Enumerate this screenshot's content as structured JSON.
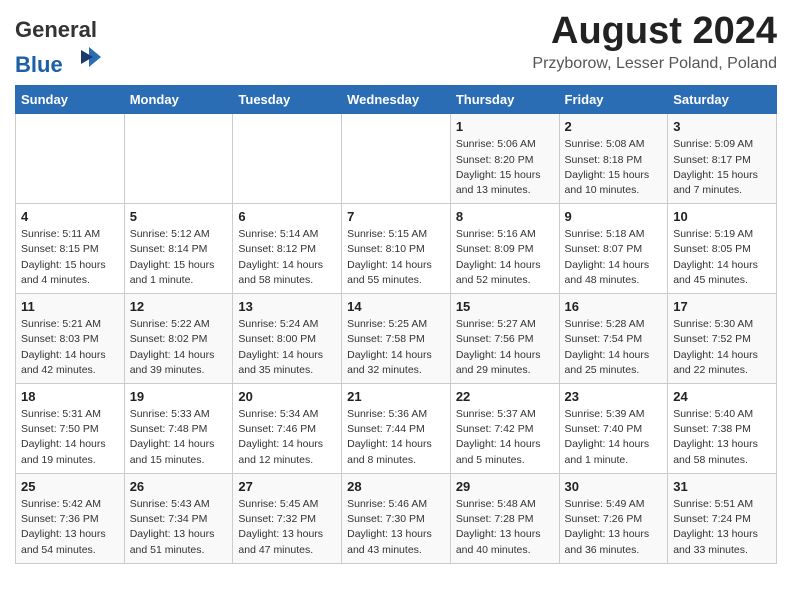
{
  "header": {
    "logo_general": "General",
    "logo_blue": "Blue",
    "title": "August 2024",
    "subtitle": "Przyborow, Lesser Poland, Poland"
  },
  "days_of_week": [
    "Sunday",
    "Monday",
    "Tuesday",
    "Wednesday",
    "Thursday",
    "Friday",
    "Saturday"
  ],
  "weeks": [
    [
      {
        "day": "",
        "info": ""
      },
      {
        "day": "",
        "info": ""
      },
      {
        "day": "",
        "info": ""
      },
      {
        "day": "",
        "info": ""
      },
      {
        "day": "1",
        "info": "Sunrise: 5:06 AM\nSunset: 8:20 PM\nDaylight: 15 hours\nand 13 minutes."
      },
      {
        "day": "2",
        "info": "Sunrise: 5:08 AM\nSunset: 8:18 PM\nDaylight: 15 hours\nand 10 minutes."
      },
      {
        "day": "3",
        "info": "Sunrise: 5:09 AM\nSunset: 8:17 PM\nDaylight: 15 hours\nand 7 minutes."
      }
    ],
    [
      {
        "day": "4",
        "info": "Sunrise: 5:11 AM\nSunset: 8:15 PM\nDaylight: 15 hours\nand 4 minutes."
      },
      {
        "day": "5",
        "info": "Sunrise: 5:12 AM\nSunset: 8:14 PM\nDaylight: 15 hours\nand 1 minute."
      },
      {
        "day": "6",
        "info": "Sunrise: 5:14 AM\nSunset: 8:12 PM\nDaylight: 14 hours\nand 58 minutes."
      },
      {
        "day": "7",
        "info": "Sunrise: 5:15 AM\nSunset: 8:10 PM\nDaylight: 14 hours\nand 55 minutes."
      },
      {
        "day": "8",
        "info": "Sunrise: 5:16 AM\nSunset: 8:09 PM\nDaylight: 14 hours\nand 52 minutes."
      },
      {
        "day": "9",
        "info": "Sunrise: 5:18 AM\nSunset: 8:07 PM\nDaylight: 14 hours\nand 48 minutes."
      },
      {
        "day": "10",
        "info": "Sunrise: 5:19 AM\nSunset: 8:05 PM\nDaylight: 14 hours\nand 45 minutes."
      }
    ],
    [
      {
        "day": "11",
        "info": "Sunrise: 5:21 AM\nSunset: 8:03 PM\nDaylight: 14 hours\nand 42 minutes."
      },
      {
        "day": "12",
        "info": "Sunrise: 5:22 AM\nSunset: 8:02 PM\nDaylight: 14 hours\nand 39 minutes."
      },
      {
        "day": "13",
        "info": "Sunrise: 5:24 AM\nSunset: 8:00 PM\nDaylight: 14 hours\nand 35 minutes."
      },
      {
        "day": "14",
        "info": "Sunrise: 5:25 AM\nSunset: 7:58 PM\nDaylight: 14 hours\nand 32 minutes."
      },
      {
        "day": "15",
        "info": "Sunrise: 5:27 AM\nSunset: 7:56 PM\nDaylight: 14 hours\nand 29 minutes."
      },
      {
        "day": "16",
        "info": "Sunrise: 5:28 AM\nSunset: 7:54 PM\nDaylight: 14 hours\nand 25 minutes."
      },
      {
        "day": "17",
        "info": "Sunrise: 5:30 AM\nSunset: 7:52 PM\nDaylight: 14 hours\nand 22 minutes."
      }
    ],
    [
      {
        "day": "18",
        "info": "Sunrise: 5:31 AM\nSunset: 7:50 PM\nDaylight: 14 hours\nand 19 minutes."
      },
      {
        "day": "19",
        "info": "Sunrise: 5:33 AM\nSunset: 7:48 PM\nDaylight: 14 hours\nand 15 minutes."
      },
      {
        "day": "20",
        "info": "Sunrise: 5:34 AM\nSunset: 7:46 PM\nDaylight: 14 hours\nand 12 minutes."
      },
      {
        "day": "21",
        "info": "Sunrise: 5:36 AM\nSunset: 7:44 PM\nDaylight: 14 hours\nand 8 minutes."
      },
      {
        "day": "22",
        "info": "Sunrise: 5:37 AM\nSunset: 7:42 PM\nDaylight: 14 hours\nand 5 minutes."
      },
      {
        "day": "23",
        "info": "Sunrise: 5:39 AM\nSunset: 7:40 PM\nDaylight: 14 hours\nand 1 minute."
      },
      {
        "day": "24",
        "info": "Sunrise: 5:40 AM\nSunset: 7:38 PM\nDaylight: 13 hours\nand 58 minutes."
      }
    ],
    [
      {
        "day": "25",
        "info": "Sunrise: 5:42 AM\nSunset: 7:36 PM\nDaylight: 13 hours\nand 54 minutes."
      },
      {
        "day": "26",
        "info": "Sunrise: 5:43 AM\nSunset: 7:34 PM\nDaylight: 13 hours\nand 51 minutes."
      },
      {
        "day": "27",
        "info": "Sunrise: 5:45 AM\nSunset: 7:32 PM\nDaylight: 13 hours\nand 47 minutes."
      },
      {
        "day": "28",
        "info": "Sunrise: 5:46 AM\nSunset: 7:30 PM\nDaylight: 13 hours\nand 43 minutes."
      },
      {
        "day": "29",
        "info": "Sunrise: 5:48 AM\nSunset: 7:28 PM\nDaylight: 13 hours\nand 40 minutes."
      },
      {
        "day": "30",
        "info": "Sunrise: 5:49 AM\nSunset: 7:26 PM\nDaylight: 13 hours\nand 36 minutes."
      },
      {
        "day": "31",
        "info": "Sunrise: 5:51 AM\nSunset: 7:24 PM\nDaylight: 13 hours\nand 33 minutes."
      }
    ]
  ]
}
